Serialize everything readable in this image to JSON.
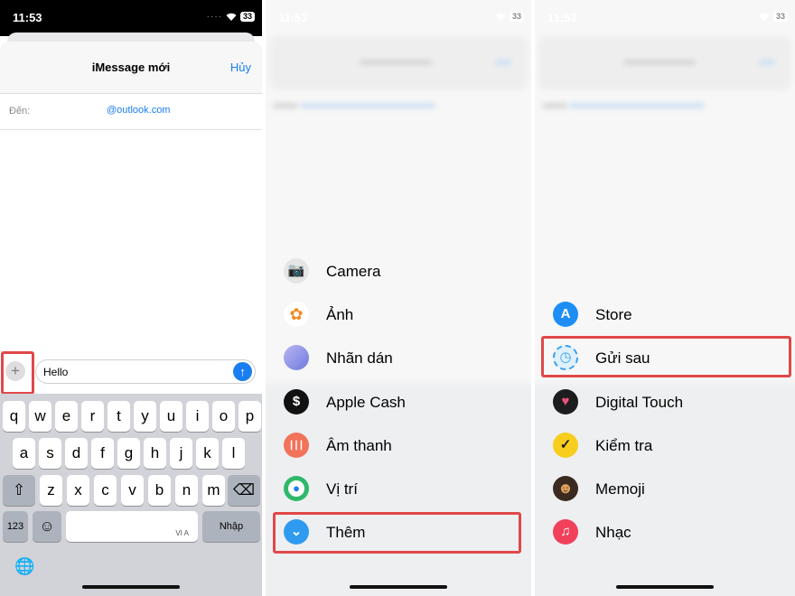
{
  "panel1": {
    "status": {
      "time": "11:53",
      "battery": "33"
    },
    "header": {
      "title": "iMessage mới",
      "cancel_label": "Hủy"
    },
    "to": {
      "label": "Đến:",
      "value": "@outlook.com"
    },
    "compose": {
      "plus_symbol": "+",
      "text": "Hello",
      "send_symbol": "↑"
    },
    "keyboard": {
      "row1": [
        "q",
        "w",
        "e",
        "r",
        "t",
        "y",
        "u",
        "i",
        "o",
        "p"
      ],
      "row2": [
        "a",
        "s",
        "d",
        "f",
        "g",
        "h",
        "j",
        "k",
        "l"
      ],
      "row3": [
        "z",
        "x",
        "c",
        "v",
        "b",
        "n",
        "m"
      ],
      "shift_symbol": "⇧",
      "delete_symbol": "⌫",
      "numbers_label": "123",
      "emoji_symbol": "☺",
      "spacebar_hint": "VI A",
      "return_label": "Nhập",
      "globe_symbol": "🌐"
    }
  },
  "panel2": {
    "status": {
      "time": "11:53",
      "battery": "33"
    },
    "items": [
      {
        "label": "Camera",
        "icon": "camera-icon",
        "glyph": "📷"
      },
      {
        "label": "Ảnh",
        "icon": "photos-icon",
        "glyph": "✿"
      },
      {
        "label": "Nhãn dán",
        "icon": "stickers-icon",
        "glyph": ""
      },
      {
        "label": "Apple Cash",
        "icon": "apple-cash-icon",
        "glyph": "$"
      },
      {
        "label": "Âm thanh",
        "icon": "audio-icon",
        "glyph": "┃┃┃"
      },
      {
        "label": "Vị trí",
        "icon": "location-icon",
        "glyph": "●"
      },
      {
        "label": "Thêm",
        "icon": "more-icon",
        "glyph": "⌄"
      }
    ]
  },
  "panel3": {
    "status": {
      "time": "11:53",
      "battery": "33"
    },
    "items": [
      {
        "label": "Store",
        "icon": "app-store-icon",
        "glyph": "A"
      },
      {
        "label": "Gửi sau",
        "icon": "send-later-icon",
        "glyph": "◷"
      },
      {
        "label": "Digital Touch",
        "icon": "digital-touch-icon",
        "glyph": "♥"
      },
      {
        "label": "Kiểm tra",
        "icon": "check-in-icon",
        "glyph": "✓"
      },
      {
        "label": "Memoji",
        "icon": "memoji-icon",
        "glyph": "☻"
      },
      {
        "label": "Nhạc",
        "icon": "music-icon",
        "glyph": "♫"
      }
    ]
  },
  "colors": {
    "accent": "#1a7ef0",
    "highlight": "#e04848"
  }
}
